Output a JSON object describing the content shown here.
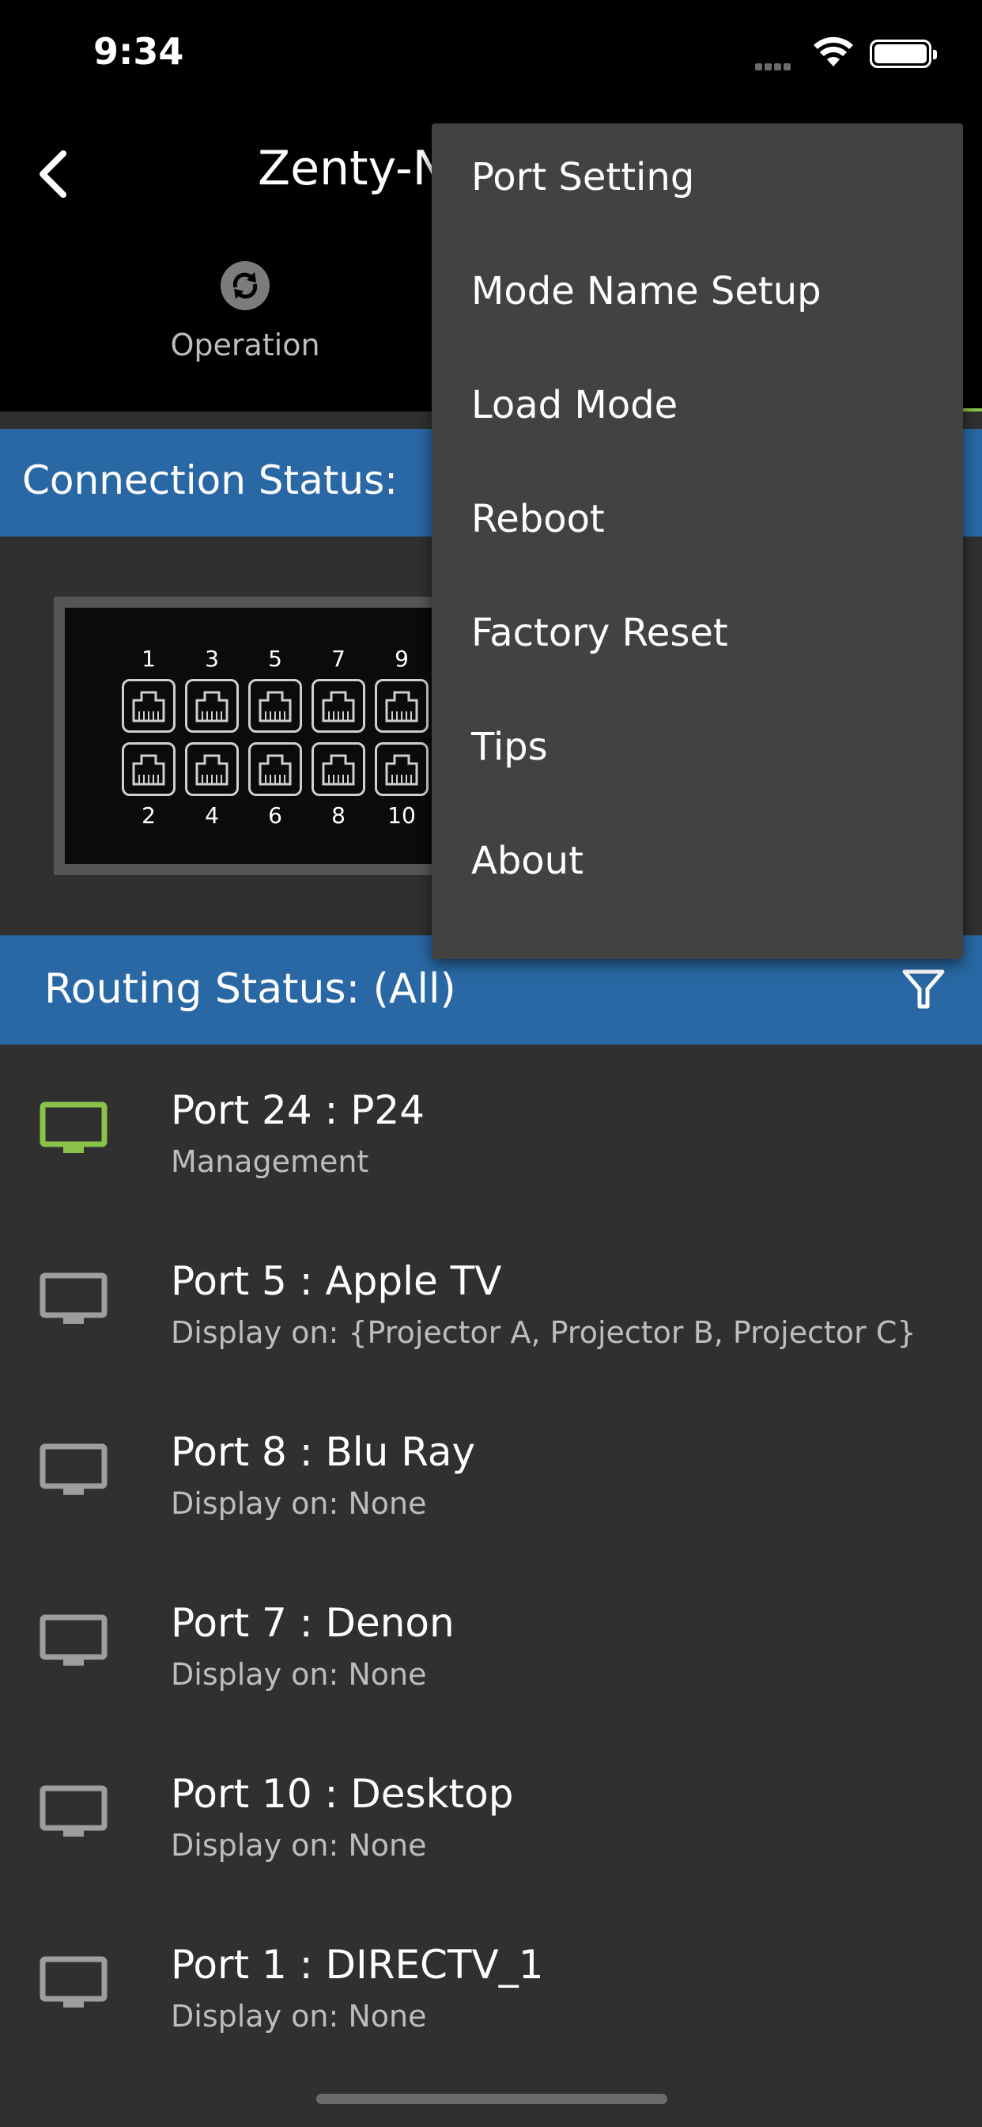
{
  "status_bar": {
    "time": "9:34"
  },
  "header": {
    "title": "Zenty-N",
    "tab_operation": "Operation"
  },
  "connection": {
    "title": "Connection Status:",
    "ports_top": [
      "1",
      "3",
      "5",
      "7",
      "9"
    ],
    "ports_bottom": [
      "2",
      "4",
      "6",
      "8",
      "10"
    ]
  },
  "routing": {
    "title": "Routing Status: (All)",
    "items": [
      {
        "name": "Port 24 : P24",
        "sub": "Management",
        "active": true
      },
      {
        "name": "Port 5 : Apple TV",
        "sub": "Display on: {Projector A, Projector B, Projector C}",
        "active": false
      },
      {
        "name": "Port 8 : Blu Ray",
        "sub": "Display on: None",
        "active": false
      },
      {
        "name": "Port 7 : Denon",
        "sub": "Display on: None",
        "active": false
      },
      {
        "name": "Port 10 : Desktop",
        "sub": "Display on: None",
        "active": false
      },
      {
        "name": "Port 1 : DIRECTV_1",
        "sub": "Display on: None",
        "active": false
      }
    ]
  },
  "menu": {
    "items": [
      "Port Setting",
      "Mode Name Setup",
      "Load Mode",
      "Reboot",
      "Factory Reset",
      "Tips",
      "About"
    ]
  },
  "colors": {
    "accent_blue": "#2968a4",
    "active_green": "#8bc34a",
    "inactive_gray": "#9e9e9e",
    "menu_bg": "#424242"
  },
  "icons": {
    "back": "chevron-left-icon",
    "operation": "sync-icon",
    "filter": "filter-icon",
    "route": "monitor-icon",
    "port": "ethernet-port-icon"
  }
}
